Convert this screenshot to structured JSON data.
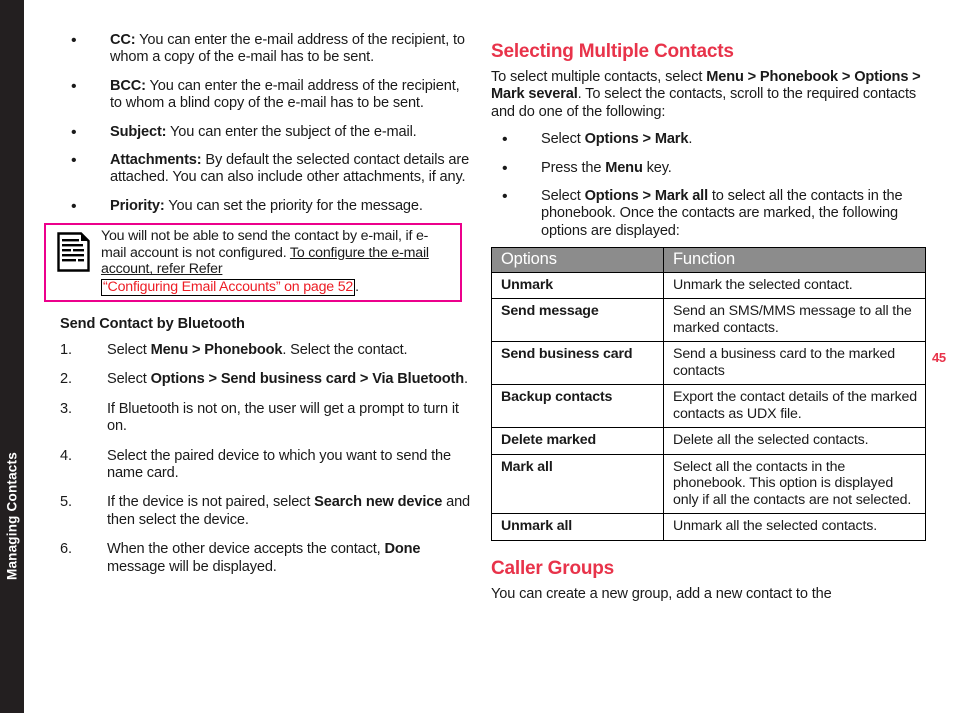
{
  "chapter": {
    "label": "Managing Contacts",
    "bar_color": "#231f20"
  },
  "page": {
    "number": "45",
    "number_color": "#e8334a"
  },
  "left_column": {
    "field_bullets": [
      {
        "marker": "•",
        "bold": "CC:",
        "text": " You can enter the e-mail address of the recipient, to whom a copy of the e-mail has to be sent."
      },
      {
        "marker": "•",
        "bold": "BCC:",
        "text": " You can enter the e-mail address of the recipient, to whom a blind copy of the e-mail has to be sent."
      },
      {
        "marker": "•",
        "bold": "Subject:",
        "text": " You can enter the subject of the e-mail."
      },
      {
        "marker": "•",
        "bold": "Attachments:",
        "text": " By default the selected contact details are attached. You can also include other attachments, if any."
      },
      {
        "marker": "•",
        "bold": "Priority:",
        "text": " You can set the priority for the message."
      }
    ],
    "note": {
      "icon": "note-document-icon",
      "border_color": "#ec008c",
      "line1": "You will not be able to send the contact by e-mail, if e-mail account is not configured. ",
      "underlined": "To configure the e-mail account, refer Refer",
      "link_text": "“Configuring Email Accounts” on page 52",
      "link_color": "#ed1c24",
      "trailing": "."
    },
    "bluetooth_heading": "Send Contact by Bluetooth",
    "bluetooth_steps": [
      {
        "marker": "1.",
        "parts": [
          {
            "t": "Select ",
            "b": false
          },
          {
            "t": "Menu > Phonebook",
            "b": true
          },
          {
            "t": ". Select the contact.",
            "b": false
          }
        ]
      },
      {
        "marker": "2.",
        "parts": [
          {
            "t": "Select ",
            "b": false
          },
          {
            "t": "Options > Send business card > Via Bluetooth",
            "b": true
          },
          {
            "t": ".",
            "b": false
          }
        ]
      },
      {
        "marker": "3.",
        "parts": [
          {
            "t": "If Bluetooth is not on, the user will get a prompt to turn it on.",
            "b": false
          }
        ]
      },
      {
        "marker": "4.",
        "parts": [
          {
            "t": "Select the paired device to which you want to send the name card.",
            "b": false
          }
        ]
      },
      {
        "marker": "5.",
        "parts": [
          {
            "t": "If the device is not paired, select ",
            "b": false
          },
          {
            "t": "Search new device",
            "b": true
          },
          {
            "t": " and then select the device.",
            "b": false
          }
        ]
      },
      {
        "marker": "6.",
        "parts": [
          {
            "t": "When the other device accepts the contact, ",
            "b": false
          },
          {
            "t": "Done",
            "b": true
          },
          {
            "t": " message will be displayed.",
            "b": false
          }
        ]
      }
    ]
  },
  "right_column": {
    "heading": "Selecting Multiple Contacts",
    "heading_color": "#e8334a",
    "intro": [
      {
        "t": "To select multiple contacts, select ",
        "b": false
      },
      {
        "t": "Menu > Phonebook > Options > Mark several",
        "b": true
      },
      {
        "t": ". To select the contacts, scroll to the required contacts and do one of the following:",
        "b": false
      }
    ],
    "action_bullets": [
      {
        "marker": "•",
        "parts": [
          {
            "t": "Select ",
            "b": false
          },
          {
            "t": "Options > Mark",
            "b": true
          },
          {
            "t": ".",
            "b": false
          }
        ]
      },
      {
        "marker": "•",
        "parts": [
          {
            "t": "Press the ",
            "b": false
          },
          {
            "t": "Menu",
            "b": true
          },
          {
            "t": " key.",
            "b": false
          }
        ]
      },
      {
        "marker": "•",
        "parts": [
          {
            "t": "Select ",
            "b": false
          },
          {
            "t": "Options > Mark all",
            "b": true
          },
          {
            "t": " to select all the contacts in the phonebook. Once the contacts are marked, the following options are displayed:",
            "b": false
          }
        ]
      }
    ],
    "table": {
      "header_bg": "#8c8c8c",
      "columns": [
        "Options",
        "Function"
      ],
      "rows": [
        [
          "Unmark",
          "Unmark the selected contact."
        ],
        [
          "Send message",
          "Send an SMS/MMS message to all the marked contacts."
        ],
        [
          "Send business card",
          "Send a business card to the marked contacts"
        ],
        [
          "Backup contacts",
          "Export the contact details of the marked contacts as UDX file."
        ],
        [
          "Delete marked",
          "Delete all the selected contacts."
        ],
        [
          "Mark all",
          "Select all the contacts in the phonebook. This option is displayed only if all the contacts are not selected."
        ],
        [
          "Unmark all",
          "Unmark all the selected contacts."
        ]
      ]
    },
    "caller_groups_heading": "Caller Groups",
    "caller_groups_text": "You can create a new group, add a new contact to the"
  }
}
